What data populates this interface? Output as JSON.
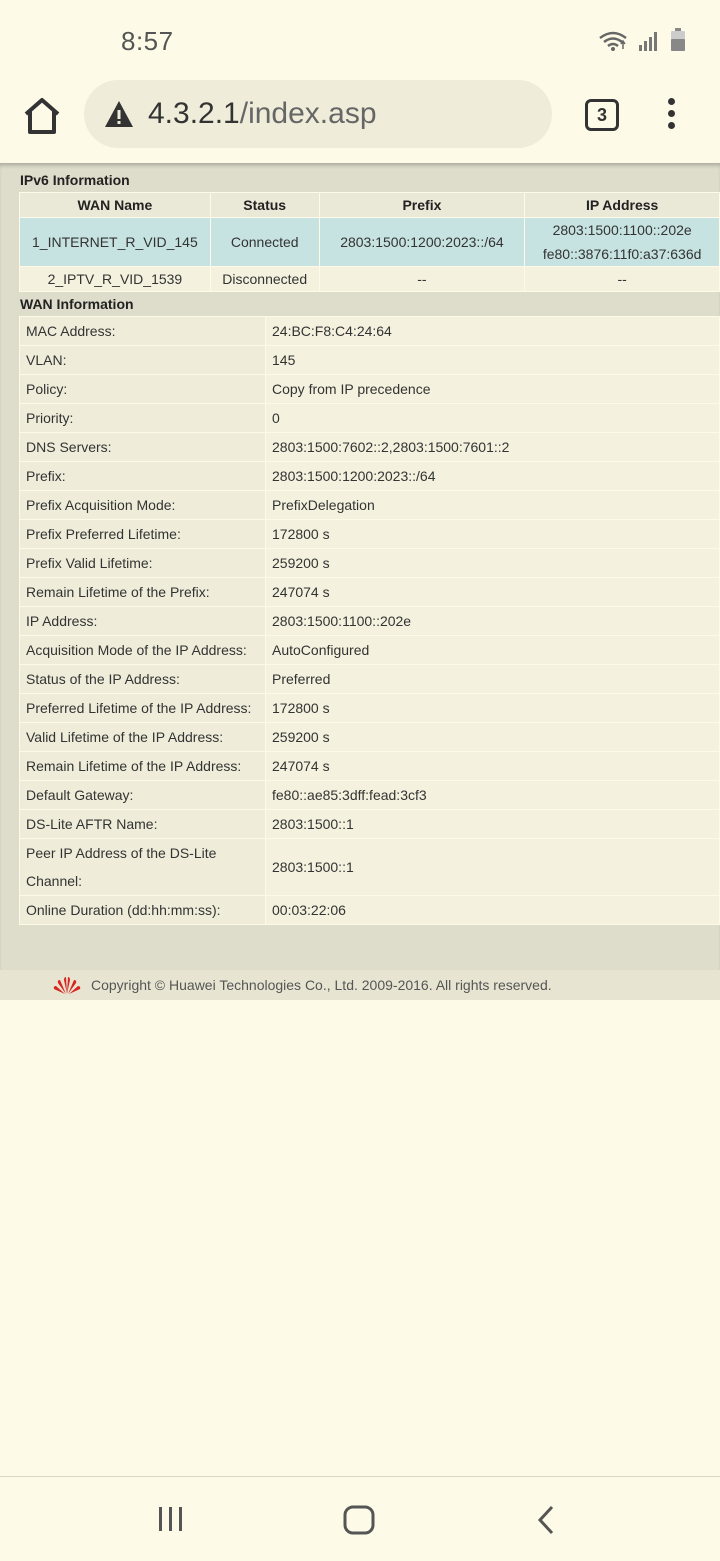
{
  "status_bar": {
    "time": "8:57"
  },
  "browser": {
    "url_host": "4.3.2.1",
    "url_path": "/index.asp",
    "tab_count": "3"
  },
  "ipv6": {
    "title": "IPv6 Information",
    "headers": [
      "WAN Name",
      "Status",
      "Prefix",
      "IP Address"
    ],
    "rows": [
      {
        "wan_name": "1_INTERNET_R_VID_145",
        "status": "Connected",
        "prefix": "2803:1500:1200:2023::/64",
        "ip_line1": "2803:1500:1100::202e",
        "ip_line2": "fe80::3876:11f0:a37:636d"
      },
      {
        "wan_name": "2_IPTV_R_VID_1539",
        "status": "Disconnected",
        "prefix": "--",
        "ip_line1": "--"
      }
    ]
  },
  "wan": {
    "title": "WAN Information",
    "rows": [
      {
        "label": "MAC Address:",
        "value": "24:BC:F8:C4:24:64"
      },
      {
        "label": "VLAN:",
        "value": "145"
      },
      {
        "label": "Policy:",
        "value": "Copy from IP precedence"
      },
      {
        "label": "Priority:",
        "value": "0"
      },
      {
        "label": "DNS Servers:",
        "value": "2803:1500:7602::2,2803:1500:7601::2"
      },
      {
        "label": "Prefix:",
        "value": "2803:1500:1200:2023::/64"
      },
      {
        "label": "Prefix Acquisition Mode:",
        "value": "PrefixDelegation"
      },
      {
        "label": "Prefix Preferred Lifetime:",
        "value": "172800 s"
      },
      {
        "label": "Prefix Valid Lifetime:",
        "value": "259200 s"
      },
      {
        "label": "Remain Lifetime of the Prefix:",
        "value": "247074 s"
      },
      {
        "label": "IP Address:",
        "value": "2803:1500:1100::202e"
      },
      {
        "label": "Acquisition Mode of the IP Address:",
        "value": "AutoConfigured"
      },
      {
        "label": "Status of the IP Address:",
        "value": "Preferred"
      },
      {
        "label": "Preferred Lifetime of the IP Address:",
        "value": "172800 s"
      },
      {
        "label": "Valid Lifetime of the IP Address:",
        "value": "259200 s"
      },
      {
        "label": "Remain Lifetime of the IP Address:",
        "value": "247074 s"
      },
      {
        "label": "Default Gateway:",
        "value": "fe80::ae85:3dff:fead:3cf3"
      },
      {
        "label": "DS-Lite AFTR Name:",
        "value": "2803:1500::1"
      },
      {
        "label": "Peer IP Address of the DS-Lite Channel:",
        "value": "2803:1500::1"
      },
      {
        "label": "Online Duration (dd:hh:mm:ss):",
        "value": "00:03:22:06"
      }
    ]
  },
  "footer": {
    "copyright": "Copyright © Huawei Technologies Co., Ltd. 2009-2016. All rights reserved."
  },
  "icons": {
    "home": "home-icon",
    "warning": "warning-icon",
    "menu": "more-vert-icon",
    "wifi": "wifi-icon",
    "signal": "signal-icon",
    "battery": "battery-icon",
    "logo": "huawei-logo"
  },
  "colors": {
    "selected_row": "#c6e3e2",
    "page_bg": "#fdfbe7"
  }
}
